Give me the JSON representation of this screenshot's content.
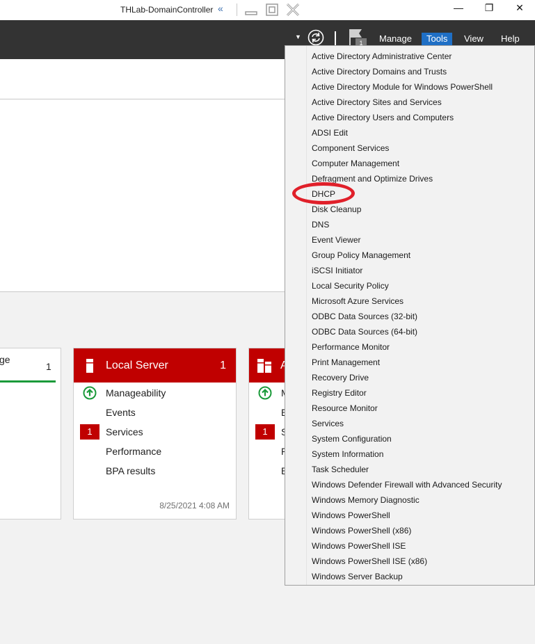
{
  "rdp_bar": {
    "title": "THLab-DomainController",
    "pin_icon": "double-chevron-left-icon"
  },
  "header": {
    "manage": "Manage",
    "tools": "Tools",
    "view": "View",
    "help": "Help",
    "flag_count": "1",
    "accent": "#1f6fc5"
  },
  "tiles": {
    "partial_left": {
      "title_fragment": "ge",
      "count": "1"
    },
    "local_server": {
      "title": "Local Server",
      "count": "1",
      "rows": [
        "Manageability",
        "Events",
        "Services",
        "Performance",
        "BPA results"
      ],
      "services_badge": "1",
      "timestamp": "8/25/2021 4:08 AM"
    },
    "partial_right": {
      "title_fragment": "A",
      "row_fragments": [
        "M",
        "E",
        "S",
        "P",
        "B"
      ],
      "services_badge": "1"
    }
  },
  "tools_menu": {
    "items": [
      "Active Directory Administrative Center",
      "Active Directory Domains and Trusts",
      "Active Directory Module for Windows PowerShell",
      "Active Directory Sites and Services",
      "Active Directory Users and Computers",
      "ADSI Edit",
      "Component Services",
      "Computer Management",
      "Defragment and Optimize Drives",
      "DHCP",
      "Disk Cleanup",
      "DNS",
      "Event Viewer",
      "Group Policy Management",
      "iSCSI Initiator",
      "Local Security Policy",
      "Microsoft Azure Services",
      "ODBC Data Sources (32-bit)",
      "ODBC Data Sources (64-bit)",
      "Performance Monitor",
      "Print Management",
      "Recovery Drive",
      "Registry Editor",
      "Resource Monitor",
      "Services",
      "System Configuration",
      "System Information",
      "Task Scheduler",
      "Windows Defender Firewall with Advanced Security",
      "Windows Memory Diagnostic",
      "Windows PowerShell",
      "Windows PowerShell (x86)",
      "Windows PowerShell ISE",
      "Windows PowerShell ISE (x86)",
      "Windows Server Backup"
    ],
    "highlighted_item": "DHCP",
    "highlight_color": "#e0202a"
  },
  "colors": {
    "tile_red": "#c00000",
    "header_bg": "#333333",
    "status_ok": "#1a9a3a"
  }
}
